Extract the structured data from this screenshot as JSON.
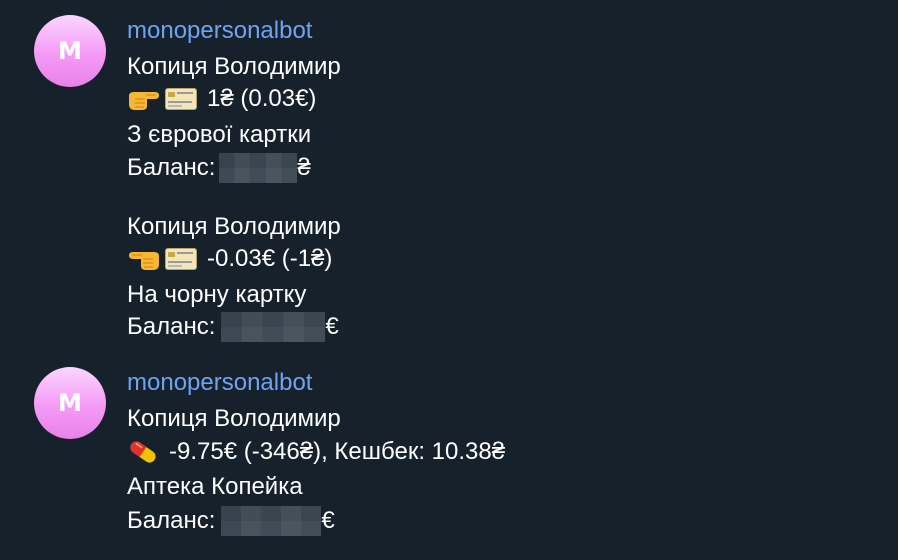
{
  "messages": [
    {
      "avatar_letter": "M",
      "sender": "monopersonalbot",
      "blocks": [
        {
          "name": "Копиця Володимир",
          "amount": "1₴ (0.03€)",
          "description": "З єврової картки",
          "balance_label": "Баланс:",
          "balance_currency": "₴",
          "icons": [
            "pointing-right-hand-icon",
            "credit-card-icon"
          ]
        },
        {
          "name": "Копиця Володимир",
          "amount": "-0.03€ (-1₴)",
          "description": "На чорну картку",
          "balance_label": "Баланс:",
          "balance_currency": "€",
          "icons": [
            "pointing-left-hand-icon",
            "credit-card-icon"
          ]
        }
      ]
    },
    {
      "avatar_letter": "M",
      "sender": "monopersonalbot",
      "blocks": [
        {
          "name": "Копиця Володимир",
          "amount": "-9.75€ (-346₴), Кешбек: 10.38₴",
          "description": "Аптека Копейка",
          "balance_label": "Баланс:",
          "balance_currency": "€",
          "icons": [
            "pill-icon"
          ]
        }
      ]
    }
  ],
  "colors": {
    "background": "#17212b",
    "sender": "#6ea4ef",
    "text": "#ffffff"
  }
}
